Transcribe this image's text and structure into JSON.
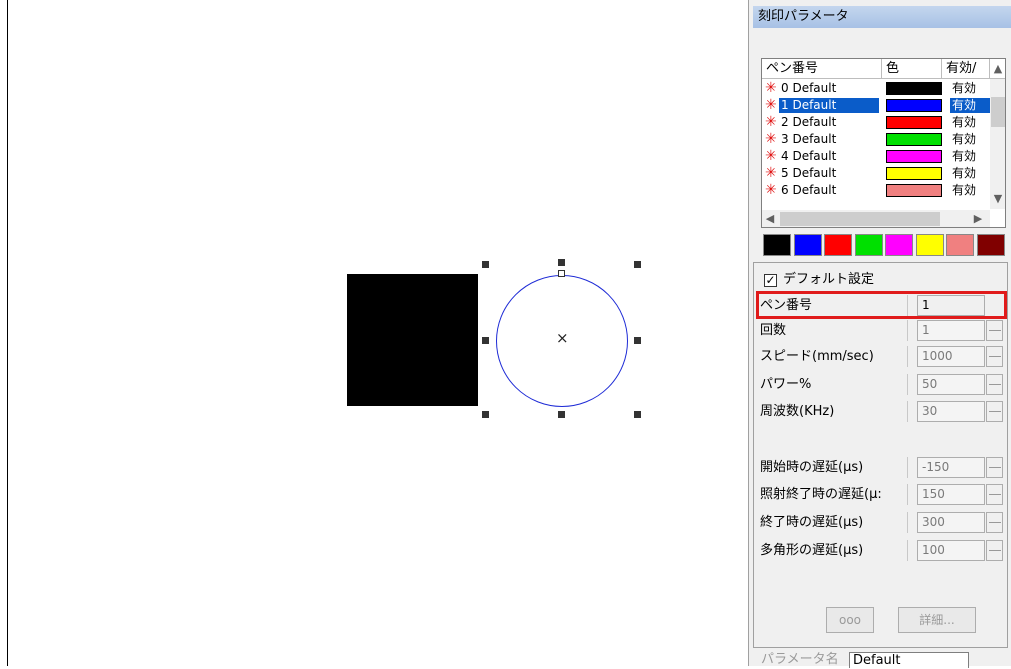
{
  "colors": {
    "circle_stroke": "#1e2bd6",
    "selection_blue": "#0a5cc9",
    "highlight_red": "#e01b1b"
  },
  "panel": {
    "title": "刻印パラメータ"
  },
  "pen_list": {
    "columns": [
      "ペン番号",
      "色",
      "有効/"
    ],
    "rows": [
      {
        "label": "0 Default",
        "color": "#000000",
        "enabled": "有効",
        "selected": false
      },
      {
        "label": "1 Default",
        "color": "#0000ff",
        "enabled": "有効",
        "selected": true
      },
      {
        "label": "2 Default",
        "color": "#ff0000",
        "enabled": "有効",
        "selected": false
      },
      {
        "label": "3 Default",
        "color": "#00e000",
        "enabled": "有効",
        "selected": false
      },
      {
        "label": "4 Default",
        "color": "#ff00ff",
        "enabled": "有効",
        "selected": false
      },
      {
        "label": "5 Default",
        "color": "#ffff00",
        "enabled": "有効",
        "selected": false
      },
      {
        "label": "6 Default",
        "color": "#f08080",
        "enabled": "有効",
        "selected": false
      }
    ],
    "icons": {
      "star": "asterisk-icon",
      "scroll_up": "chevron-up-icon",
      "scroll_down": "chevron-down-icon",
      "scroll_left": "chevron-left-icon",
      "scroll_right": "chevron-right-icon"
    }
  },
  "palette": [
    "#000000",
    "#0000ff",
    "#ff0000",
    "#00e000",
    "#ff00ff",
    "#ffff00",
    "#f08080",
    "#800000"
  ],
  "params": {
    "default_label": "デフォルト設定",
    "default_checked": "✓",
    "rows": [
      {
        "label": "ペン番号",
        "value": "1"
      },
      {
        "label": "回数",
        "value": "1"
      },
      {
        "label": "スピード(mm/sec)",
        "value": "1000"
      },
      {
        "label": "パワー%",
        "value": "50"
      },
      {
        "label": "周波数(KHz)",
        "value": "30"
      },
      {
        "label": "開始時の遅延(μs)",
        "value": "-150"
      },
      {
        "label": "照射終了時の遅延(μ:",
        "value": "150"
      },
      {
        "label": "終了時の遅延(μs)",
        "value": "300"
      },
      {
        "label": "多角形の遅延(μs)",
        "value": "100"
      }
    ],
    "btn_advanced_icon": "ooo",
    "btn_detail": "詳細..."
  },
  "bottom": {
    "tab_label": "パラメータ名",
    "field_value": "Default"
  }
}
